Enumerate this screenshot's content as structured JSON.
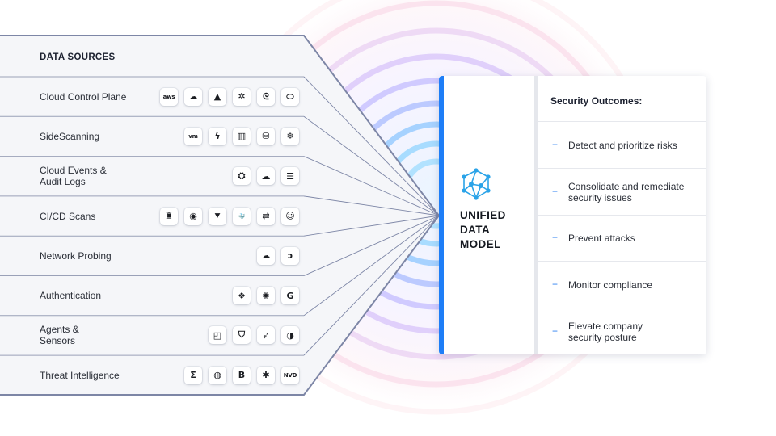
{
  "data_sources": {
    "header": "DATA SOURCES",
    "rows": [
      {
        "label": "Cloud Control Plane",
        "icons": [
          {
            "name": "aws-icon",
            "glyph": "aws"
          },
          {
            "name": "google-cloud-icon",
            "glyph": "☁"
          },
          {
            "name": "azure-icon",
            "glyph": "▲"
          },
          {
            "name": "kubernetes-icon",
            "glyph": "✲"
          },
          {
            "name": "alibaba-cloud-icon",
            "glyph": "ᘓ"
          },
          {
            "name": "oracle-cloud-icon",
            "glyph": "⬭"
          }
        ]
      },
      {
        "label": "SideScanning",
        "icons": [
          {
            "name": "vmware-icon",
            "glyph": "vm"
          },
          {
            "name": "lambda-function-icon",
            "glyph": "ϟ"
          },
          {
            "name": "container-registry-icon",
            "glyph": "▥"
          },
          {
            "name": "database-bucket-icon",
            "glyph": "⛁"
          },
          {
            "name": "snowflake-icon",
            "glyph": "❄"
          }
        ]
      },
      {
        "label": "Cloud Events &\nAudit Logs",
        "icons": [
          {
            "name": "cloudtrail-icon",
            "glyph": "⛭"
          },
          {
            "name": "cloud-logging-icon",
            "glyph": "☁"
          },
          {
            "name": "event-hub-icon",
            "glyph": "☰"
          }
        ]
      },
      {
        "label": "CI/CD Scans",
        "icons": [
          {
            "name": "jenkins-icon",
            "glyph": "♜"
          },
          {
            "name": "github-icon",
            "glyph": "◉"
          },
          {
            "name": "terraform-icon",
            "glyph": "⯆"
          },
          {
            "name": "docker-icon",
            "glyph": "🐳"
          },
          {
            "name": "jfrog-icon",
            "glyph": "⇄"
          },
          {
            "name": "ci-bot-icon",
            "glyph": "☺"
          }
        ]
      },
      {
        "label": "Network Probing",
        "icons": [
          {
            "name": "cloudflare-icon",
            "glyph": "☁"
          },
          {
            "name": "akamai-icon",
            "glyph": "ↄ"
          }
        ]
      },
      {
        "label": "Authentication",
        "icons": [
          {
            "name": "okta-diamond-icon",
            "glyph": "❖"
          },
          {
            "name": "okta-sun-icon",
            "glyph": "✺"
          },
          {
            "name": "google-icon",
            "glyph": "G"
          }
        ]
      },
      {
        "label": "Agents &\nSensors",
        "icons": [
          {
            "name": "endpoint-agent-icon",
            "glyph": "◰"
          },
          {
            "name": "shield-icon",
            "glyph": "⛉"
          },
          {
            "name": "crowdstrike-falcon-icon",
            "glyph": "➶"
          },
          {
            "name": "sensor-icon",
            "glyph": "◑"
          }
        ]
      },
      {
        "label": "Threat Intelligence",
        "icons": [
          {
            "name": "sigma-icon",
            "glyph": "Σ"
          },
          {
            "name": "threat-feed-globe-icon",
            "glyph": "◍"
          },
          {
            "name": "b-feed-icon",
            "glyph": "B"
          },
          {
            "name": "bug-icon",
            "glyph": "✱"
          },
          {
            "name": "nvd-icon",
            "glyph": "NVD"
          }
        ]
      }
    ]
  },
  "unified_data_model": {
    "title_lines": [
      "UNIFIED",
      "DATA",
      "MODEL"
    ],
    "logo_icon": "network-graph-icon"
  },
  "security_outcomes": {
    "header": "Security Outcomes:",
    "items": [
      {
        "text": "Detect and prioritize risks"
      },
      {
        "text": "Consolidate and remediate\nsecurity issues"
      },
      {
        "text": "Prevent attacks"
      },
      {
        "text": "Monitor compliance"
      },
      {
        "text": "Elevate company\nsecurity posture"
      }
    ]
  },
  "colors": {
    "accent": "#1e7ef7",
    "funnel_border": "#7d86a6",
    "plus": "#2b7ff0"
  }
}
